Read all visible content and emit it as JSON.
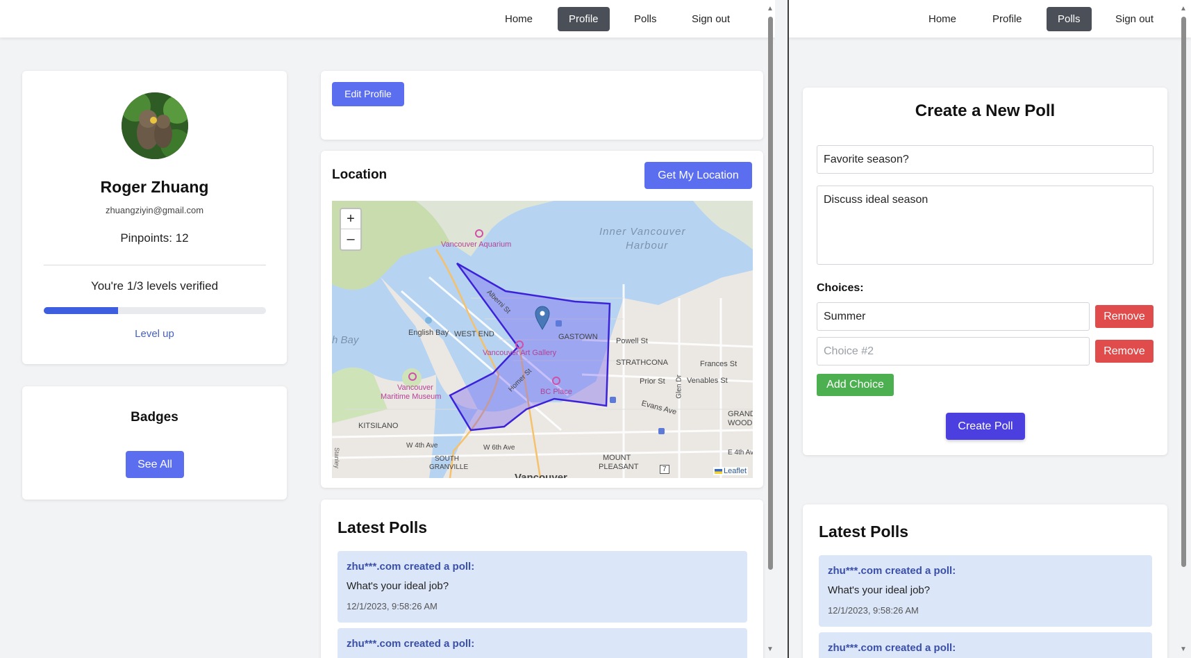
{
  "colors": {
    "primary": "#5b6ef0",
    "nav_active": "#4b4f58",
    "danger": "#e04b4b",
    "success": "#4caf50",
    "poll_bg": "#dbe6f8",
    "poll_author": "#3a4fa8",
    "polygon": "#3b22d8"
  },
  "left": {
    "nav": {
      "items": [
        {
          "label": "Home",
          "active": false
        },
        {
          "label": "Profile",
          "active": true
        },
        {
          "label": "Polls",
          "active": false
        },
        {
          "label": "Sign out",
          "active": false
        }
      ]
    },
    "profile": {
      "name": "Roger Zhuang",
      "email": "zhuangziyin@gmail.com",
      "pinpoints": "Pinpoints: 12",
      "verified_text": "You're 1/3 levels verified",
      "verified_progress": 0.333,
      "level_up": "Level up"
    },
    "badges": {
      "title": "Badges",
      "see_all": "See All"
    },
    "edit_profile": "Edit Profile",
    "location": {
      "title": "Location",
      "get_location": "Get My Location",
      "zoom_in": "+",
      "zoom_out": "–",
      "attribution": "Leaflet",
      "labels": {
        "inner_harbour_1": "Inner Vancouver",
        "inner_harbour_2": "Harbour",
        "aquarium": "Vancouver Aquarium",
        "english_bay": "English Bay",
        "west_end": "WEST END",
        "gastown": "GASTOWN",
        "powell": "Powell St",
        "art_gallery": "Vancouver Art Gallery",
        "strathcona": "STRATHCONA",
        "frances": "Frances St",
        "prior": "Prior St",
        "venables": "Venables St",
        "bc_place": "BC Place",
        "maritime_1": "Vancouver",
        "maritime_2": "Maritime Museum",
        "evans": "Evans Ave",
        "kitsilano": "KITSILANO",
        "grandview_1": "GRANDVIE",
        "grandview_2": "WOODLAN",
        "w4th": "W 4th Ave",
        "w6th": "W 6th Ave",
        "south_granville_1": "SOUTH",
        "south_granville_2": "GRANVILLE",
        "mount_pleasant_1": "MOUNT",
        "mount_pleasant_2": "PLEASANT",
        "e4th": "E 4th Av",
        "vancouver": "Vancouver",
        "alberni": "Alberni St",
        "homer": "Homer St",
        "glen": "Glen Dr",
        "bay": "h Bay",
        "hwy": "7",
        "side_left": "Stanley"
      }
    },
    "latest_polls": {
      "title": "Latest Polls",
      "items": [
        {
          "author": "zhu***.com created a poll:",
          "question": "What's your ideal job?",
          "timestamp": "12/1/2023, 9:58:26 AM"
        },
        {
          "author": "zhu***.com created a poll:"
        }
      ]
    }
  },
  "right": {
    "nav": {
      "items": [
        {
          "label": "Home",
          "active": false
        },
        {
          "label": "Profile",
          "active": false
        },
        {
          "label": "Polls",
          "active": true
        },
        {
          "label": "Sign out",
          "active": false
        }
      ]
    },
    "create_poll": {
      "title": "Create a New Poll",
      "question_value": "Favorite season?",
      "description_value": "Discuss ideal season",
      "choices_label": "Choices:",
      "choices": [
        {
          "value": "Summer",
          "placeholder": ""
        },
        {
          "value": "",
          "placeholder": "Choice #2"
        }
      ],
      "remove_label": "Remove",
      "add_choice": "Add Choice",
      "submit": "Create Poll"
    },
    "latest_polls": {
      "title": "Latest Polls",
      "items": [
        {
          "author": "zhu***.com created a poll:",
          "question": "What's your ideal job?",
          "timestamp": "12/1/2023, 9:58:26 AM"
        },
        {
          "author": "zhu***.com created a poll:"
        }
      ]
    }
  }
}
